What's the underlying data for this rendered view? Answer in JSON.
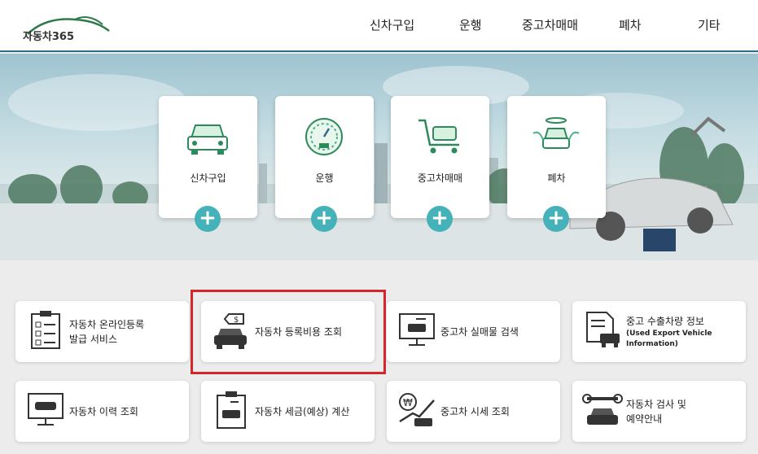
{
  "header": {
    "logo_text": "자동차365",
    "nav": [
      "신차구입",
      "운행",
      "중고차매매",
      "폐차",
      "기타"
    ]
  },
  "hero_cards": [
    {
      "label": "신차구입",
      "icon": "new-car-icon"
    },
    {
      "label": "운행",
      "icon": "speedometer-icon"
    },
    {
      "label": "중고차매매",
      "icon": "cart-car-icon"
    },
    {
      "label": "폐차",
      "icon": "angel-car-icon"
    }
  ],
  "services": [
    {
      "line1": "자동차 온라인등록",
      "line2": "발급 서비스",
      "icon": "checklist-icon"
    },
    {
      "line1": "자동차 등록비용 조회",
      "line2": "",
      "icon": "car-price-tag-icon"
    },
    {
      "line1": "중고차 실매물 검색",
      "line2": "",
      "icon": "monitor-car-icon"
    },
    {
      "line1": "중고 수출차량 정보",
      "sub1": "(Used Export Vehicle",
      "sub2": "Information)",
      "icon": "document-car-icon"
    },
    {
      "line1": "자동차 이력 조회",
      "line2": "",
      "icon": "history-monitor-icon"
    },
    {
      "line1": "자동차 세금(예상) 계산",
      "line2": "",
      "icon": "tax-clipboard-icon"
    },
    {
      "line1": "중고차 시세 조회",
      "line2": "",
      "icon": "won-trend-icon"
    },
    {
      "line1": "자동차 검사 및",
      "line2": "예약안내",
      "icon": "wrench-car-icon"
    }
  ],
  "plus_symbol": "+",
  "colors": {
    "accent": "#45b1b8",
    "highlight": "#d6262d",
    "icon": "#2e8a5a"
  }
}
